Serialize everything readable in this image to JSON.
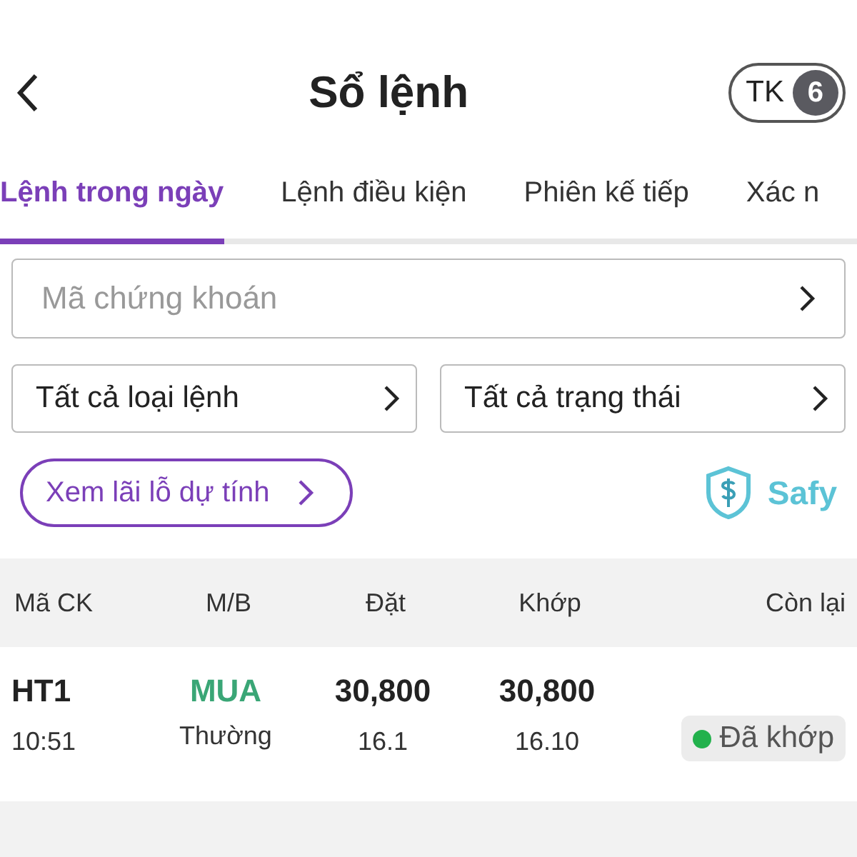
{
  "header": {
    "title": "Sổ lệnh",
    "account_label": "TK",
    "account_number": "6"
  },
  "tabs": [
    {
      "label": "Lệnh trong ngày",
      "selected": true
    },
    {
      "label": "Lệnh điều kiện",
      "selected": false
    },
    {
      "label": "Phiên kế tiếp",
      "selected": false
    },
    {
      "label": "Xác n",
      "selected": false
    }
  ],
  "search": {
    "placeholder": "Mã chứng khoán"
  },
  "filters": [
    "Tất cả loại lệnh",
    "Tất cả trạng thái"
  ],
  "profit_button": "Xem lãi lỗ dự tính",
  "safy_label": "Safy",
  "table": {
    "columns": [
      "Mã CK",
      "M/B",
      "Đặt",
      "Khớp",
      "Còn lại"
    ],
    "rows": [
      {
        "symbol": "HT1",
        "time": "10:51",
        "side": {
          "text": "MUA",
          "kind": "buy"
        },
        "order_type": "Thường",
        "price": "30,800",
        "quantity": "16.1",
        "matched_price": "30,800",
        "matched_quantity": "16.10",
        "status": {
          "text": "Đã khớp",
          "color": "#22b14c"
        }
      }
    ]
  }
}
